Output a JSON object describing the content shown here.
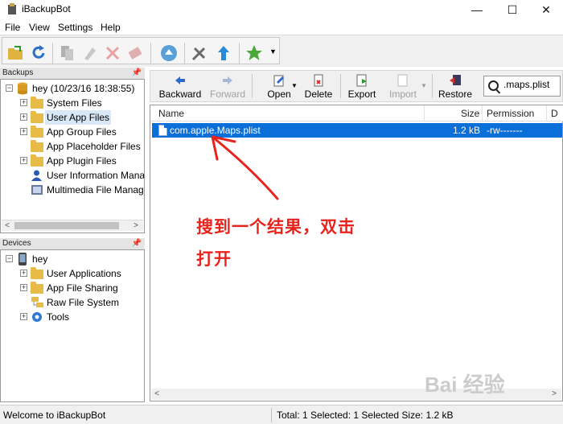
{
  "window": {
    "title": "iBackupBot",
    "min": "—",
    "max": "☐",
    "close": "✕"
  },
  "menu": [
    "File",
    "View",
    "Settings",
    "Help"
  ],
  "backups": {
    "title": "Backups",
    "root": "hey (10/23/16 18:38:55)",
    "items": [
      "System Files",
      "User App Files",
      "App Group Files",
      "App Placeholder Files",
      "App Plugin Files",
      "User Information Mana",
      "Multimedia File Manag"
    ]
  },
  "devices": {
    "title": "Devices",
    "root": "hey",
    "items": [
      "User Applications",
      "App File Sharing",
      "Raw File System",
      "Tools"
    ]
  },
  "right_toolbar": {
    "backward": "Backward",
    "forward": "Forward",
    "open": "Open",
    "delete": "Delete",
    "export": "Export",
    "import": "Import",
    "restore": "Restore"
  },
  "search": {
    "value": ".maps.plist"
  },
  "file_list": {
    "columns": {
      "name": "Name",
      "size": "Size",
      "permission": "Permission",
      "d": "D"
    },
    "rows": [
      {
        "name": "com.apple.Maps.plist",
        "size": "1.2 kB",
        "permission": "-rw-------"
      }
    ]
  },
  "annotation": {
    "line1": "搜到一个结果，双击",
    "line2": "打开"
  },
  "status": {
    "left": "Welcome to iBackupBot",
    "right": "Total: 1 Selected: 1 Selected Size: 1.2 kB"
  },
  "watermark": "Bai 经验",
  "colors": {
    "selection": "#0a6fd8",
    "annotation": "#e8231c",
    "folder": "#e7bb47"
  }
}
